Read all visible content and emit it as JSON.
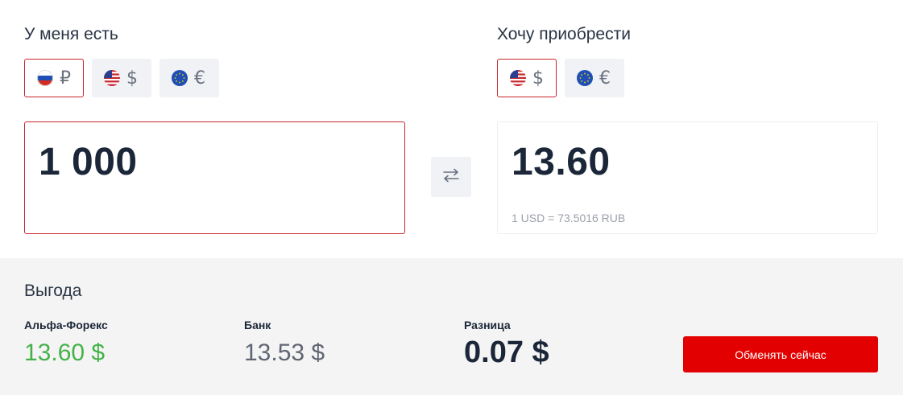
{
  "from": {
    "label": "У меня есть",
    "currencies": [
      {
        "code": "RUB",
        "symbol": "₽",
        "flag": "ru-flag-icon",
        "active": true
      },
      {
        "code": "USD",
        "symbol": "$",
        "flag": "us-flag-icon",
        "active": false
      },
      {
        "code": "EUR",
        "symbol": "€",
        "flag": "eu-flag-icon",
        "active": false
      }
    ],
    "amount": "1 000"
  },
  "to": {
    "label": "Хочу приобрести",
    "currencies": [
      {
        "code": "USD",
        "symbol": "$",
        "flag": "us-flag-icon",
        "active": true
      },
      {
        "code": "EUR",
        "symbol": "€",
        "flag": "eu-flag-icon",
        "active": false
      }
    ],
    "amount": "13.60",
    "rate": "1 USD = 73.5016 RUB"
  },
  "swap": {
    "icon": "swap-arrows-icon"
  },
  "benefit": {
    "title": "Выгода",
    "alfa": {
      "label": "Альфа-Форекс",
      "value": "13.60 $"
    },
    "bank": {
      "label": "Банк",
      "value": "13.53 $"
    },
    "diff": {
      "label": "Разница",
      "value": "0.07 $"
    },
    "button": "Обменять сейчас"
  },
  "colors": {
    "accent": "#e30000",
    "active_border": "#c8252c",
    "positive": "#44b249",
    "text": "#1b2638"
  }
}
